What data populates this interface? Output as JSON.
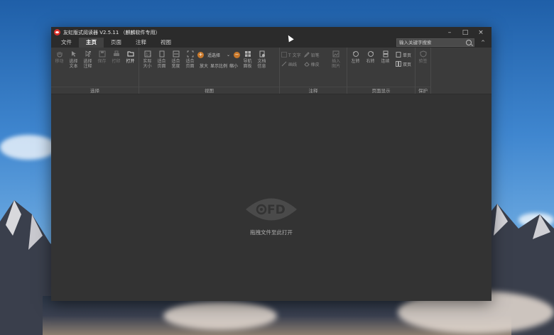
{
  "window": {
    "title": "友虹版式阅读器 V2.5.11 （麒麟软件专用）",
    "controls": {
      "minimize": "–",
      "maximize": "□",
      "close": "×"
    }
  },
  "menu": {
    "tabs": [
      {
        "label": "文件",
        "active": false
      },
      {
        "label": "主页",
        "active": true
      },
      {
        "label": "页面",
        "active": false
      },
      {
        "label": "注释",
        "active": false
      },
      {
        "label": "视图",
        "active": false
      }
    ],
    "search_placeholder": "输入关键字搜索",
    "collapse": "^"
  },
  "ribbon": {
    "select_group": {
      "label": "选择",
      "tools": [
        {
          "label": "移动",
          "icon": "hand-icon",
          "enabled": false
        },
        {
          "label": "选择\n文本",
          "icon": "cursor-select-icon",
          "enabled": false
        },
        {
          "label": "选择\n注释",
          "icon": "annotation-select-icon",
          "enabled": false
        },
        {
          "label": "保存",
          "icon": "save-icon",
          "enabled": false
        },
        {
          "label": "打印",
          "icon": "print-icon",
          "enabled": false
        },
        {
          "label": "打开",
          "icon": "folder-open-icon",
          "enabled": true
        }
      ]
    },
    "view_group": {
      "label": "视图",
      "tools": [
        {
          "label": "实际\n大小",
          "icon": "actual-size-icon"
        },
        {
          "label": "适合\n页面",
          "icon": "fit-page-icon"
        },
        {
          "label": "适合\n宽度",
          "icon": "fit-width-icon"
        },
        {
          "label": "适合\n页面",
          "icon": "fit-visible-icon"
        }
      ],
      "zoom": {
        "zoom_in": "放大",
        "ratio": "显示比例",
        "zoom_out": "缩小",
        "select_value": "适选择"
      },
      "tools_after": [
        {
          "label": "导航\n面板",
          "icon": "nav-panel-icon"
        },
        {
          "label": "文档\n信息",
          "icon": "doc-info-icon"
        }
      ]
    },
    "annotation_group": {
      "label": "注释",
      "small_tools": [
        {
          "label": "T 文字",
          "icon": "text-box-icon"
        },
        {
          "label": "画线",
          "icon": "line-icon"
        },
        {
          "label": "铅笔",
          "icon": "pencil-icon"
        },
        {
          "label": "橡皮",
          "icon": "eraser-icon"
        }
      ],
      "tools": [
        {
          "label": "插入\n图片",
          "icon": "insert-image-icon"
        }
      ]
    },
    "page_group": {
      "label": "页面显示",
      "tools": [
        {
          "label": "左转",
          "icon": "rotate-left-icon"
        },
        {
          "label": "右转",
          "icon": "rotate-right-icon"
        },
        {
          "label": "连续",
          "icon": "continuous-icon"
        }
      ],
      "small_tools": [
        {
          "label": "单页",
          "icon": "single-page-icon"
        },
        {
          "label": "双页",
          "icon": "double-page-icon"
        }
      ]
    },
    "protect_group": {
      "label": "保护",
      "tools": [
        {
          "label": "验签",
          "icon": "shield-icon"
        }
      ]
    }
  },
  "content": {
    "logo_text": "FD",
    "drop_hint": "拖拽文件至此打开"
  }
}
